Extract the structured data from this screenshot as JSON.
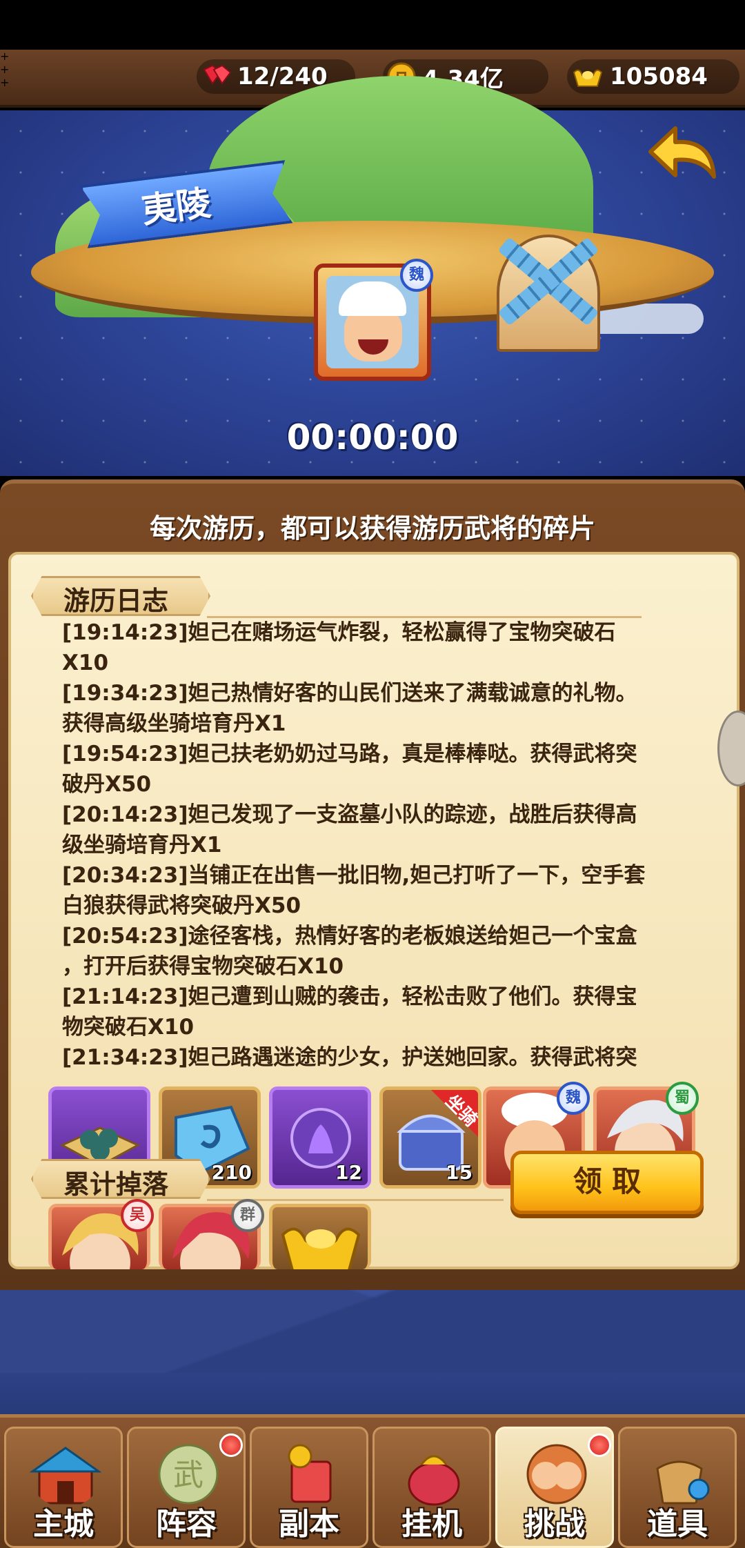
{
  "resources": {
    "stamina": {
      "icon": "heart-icon",
      "value": "12/240"
    },
    "coins": {
      "icon": "coin-icon",
      "value": "4.34亿"
    },
    "gold": {
      "icon": "gold-ingot-icon",
      "value": "105084"
    }
  },
  "map": {
    "location": "夷陵",
    "timer": "00:00:00",
    "hero_faction": "魏"
  },
  "panel": {
    "header": "每次游历，都可以获得游历武将的碎片",
    "log_title": "游历日志",
    "log": [
      "[19:14:23]妲己在赌场运气炸裂，轻松赢得了宝物突破石",
      "X10",
      "[19:34:23]妲己热情好客的山民们送来了满载诚意的礼物。",
      "获得高级坐骑培育丹X1",
      "[19:54:23]妲己扶老奶奶过马路，真是棒棒哒。获得武将突",
      "破丹X50",
      "[20:14:23]妲己发现了一支盗墓小队的踪迹，战胜后获得高",
      "级坐骑培育丹X1",
      "[20:34:23]当铺正在出售一批旧物,妲己打听了一下，空手套",
      "白狼获得武将突破丹X50",
      "[20:54:23]途径客栈，热情好客的老板娘送给妲己一个宝盒",
      "，打开后获得宝物突破石X10",
      "[21:14:23]妲己遭到山贼的袭击，轻松击败了他们。获得宝",
      "物突破石X10",
      "[21:34:23]妲己路遇迷途的少女，护送她回家。获得武将突"
    ],
    "drops_title": "累计掉落",
    "claim_label": "领 取",
    "items": [
      {
        "name": "jade-beads",
        "count": ""
      },
      {
        "name": "blue-stone",
        "count": "210"
      },
      {
        "name": "purple-orb",
        "count": "12"
      },
      {
        "name": "mount-chest",
        "count": "15",
        "ribbon": "坐骑"
      },
      {
        "name": "chef-hero",
        "badge": "魏"
      },
      {
        "name": "white-hair-hero",
        "badge": "蜀"
      }
    ],
    "items_row2": [
      {
        "name": "blonde-hero",
        "badge": "吴"
      },
      {
        "name": "red-hair-hero",
        "badge": "群"
      },
      {
        "name": "gold-ingot",
        "count": ""
      }
    ]
  },
  "nav": [
    {
      "label": "主城",
      "icon": "castle-icon",
      "active": false,
      "dot": false
    },
    {
      "label": "阵容",
      "icon": "formation-icon",
      "active": false,
      "dot": true
    },
    {
      "label": "副本",
      "icon": "dungeon-icon",
      "active": false,
      "dot": false
    },
    {
      "label": "挂机",
      "icon": "idle-icon",
      "active": false,
      "dot": false
    },
    {
      "label": "挑战",
      "icon": "challenge-icon",
      "active": true,
      "dot": true
    },
    {
      "label": "道具",
      "icon": "items-icon",
      "active": false,
      "dot": false
    }
  ],
  "colors": {
    "accent": "#ffc21a",
    "wood": "#6b4226",
    "parchment": "#fbf0cf",
    "sky": "#2a3f8f"
  }
}
